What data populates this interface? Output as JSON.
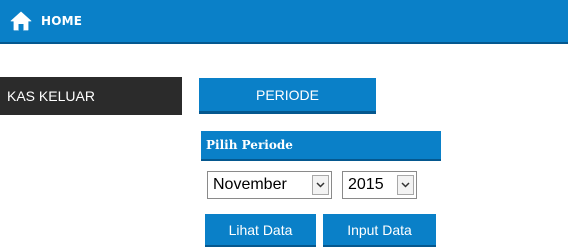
{
  "header": {
    "home_label": "HOME",
    "home_icon": "home-icon"
  },
  "sidebar": {
    "kas_keluar_label": "KAS KELUAR"
  },
  "tabs": {
    "periode_label": "PERIODE"
  },
  "panel": {
    "title": "Pilih Periode",
    "month_selected": "November",
    "year_selected": "2015",
    "lihat_data_label": "Lihat Data",
    "input_data_label": "Input Data"
  },
  "colors": {
    "accent": "#0a80c8",
    "accent_dark": "#05588f",
    "sidebar_bg": "#2b2b2b"
  }
}
